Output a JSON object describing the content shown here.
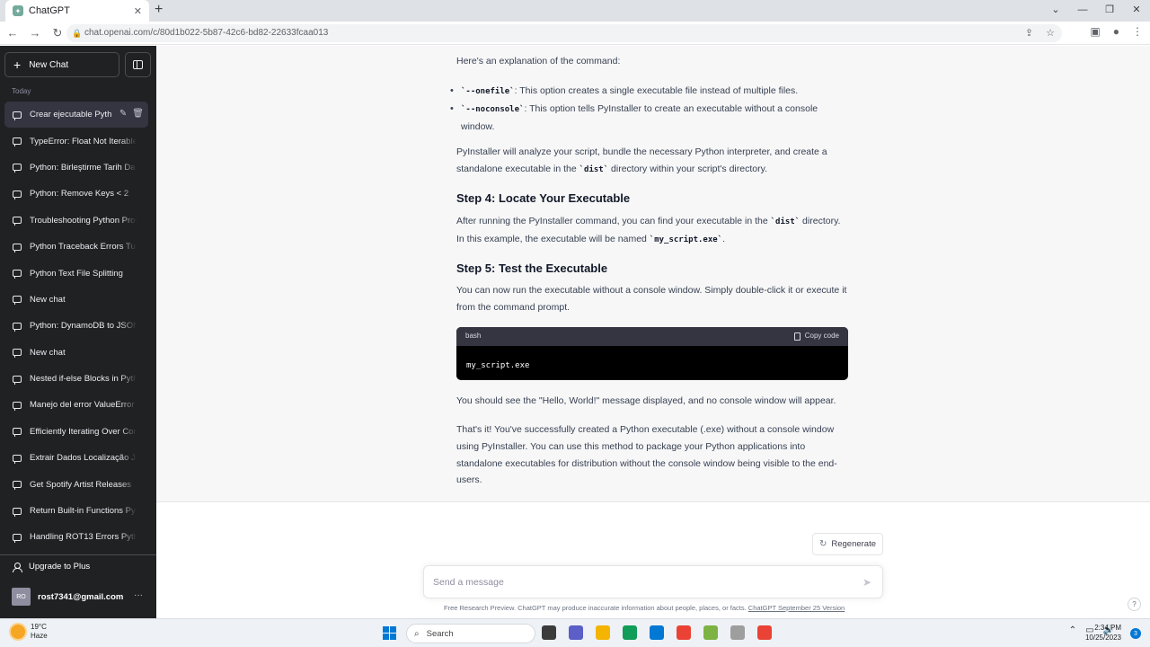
{
  "browser": {
    "tab_title": "ChatGPT",
    "url": "chat.openai.com/c/80d1b022-5b87-42c6-bd82-22633fcaa013"
  },
  "sidebar": {
    "new_chat_label": "New Chat",
    "section_label": "Today",
    "chats": [
      "Crear ejecutable Pyth",
      "TypeError: Float Not Iterable",
      "Python: Birleştirme Tarih Da",
      "Python: Remove Keys < 2",
      "Troubleshooting Python Prog",
      "Python Traceback Errors Tut",
      "Python Text File Splitting",
      "New chat",
      "Python: DynamoDB to JSON",
      "New chat",
      "Nested if-else Blocks in Pyth",
      "Manejo del error ValueError",
      "Efficiently Iterating Over Con",
      "Extrair Dados Localização JS",
      "Get Spotify Artist Releases",
      "Return Built-in Functions Pyt",
      "Handling ROT13 Errors Pytho"
    ],
    "upgrade_label": "Upgrade to Plus",
    "account_initials": "RO",
    "account_email": "rost7341@gmail.com"
  },
  "answer": {
    "intro": "Here's an explanation of the command:",
    "bullet1_code": "`--onefile`",
    "bullet1_text": ": This option creates a single executable file instead of multiple files.",
    "bullet2_code": "`--noconsole`",
    "bullet2_text": ": This option tells PyInstaller to create an executable without a console window.",
    "para1_a": "PyInstaller will analyze your script, bundle the necessary Python interpreter, and create a standalone executable in the ",
    "para1_code": "`dist`",
    "para1_b": " directory within your script's directory.",
    "step4_heading": "Step 4: Locate Your Executable",
    "step4_a": "After running the PyInstaller command, you can find your executable in the ",
    "step4_code1": "`dist`",
    "step4_b": " directory. In this example, the executable will be named ",
    "step4_code2": "`my_script.exe`",
    "step4_c": ".",
    "step5_heading": "Step 5: Test the Executable",
    "step5_text": "You can now run the executable without a console window. Simply double-click it or execute it from the command prompt.",
    "code_lang": "bash",
    "copy_label": "Copy code",
    "code": "my_script.exe",
    "para2": "You should see the \"Hello, World!\" message displayed, and no console window will appear.",
    "para3": "That's it! You've successfully created a Python executable (.exe) without a console window using PyInstaller. You can use this method to package your Python applications into standalone executables for distribution without the console window being visible to the end-users."
  },
  "composer": {
    "regenerate_label": "Regenerate",
    "placeholder": "Send a message",
    "disclaimer_text": "Free Research Preview. ChatGPT may produce inaccurate information about people, places, or facts. ",
    "disclaimer_link": "ChatGPT September 25 Version",
    "help": "?"
  },
  "taskbar": {
    "temperature": "19°C",
    "weather": "Haze",
    "search_label": "Search",
    "time": "2:34 PM",
    "date": "10/25/2023",
    "notifications": "3",
    "icon_colors": [
      "#3b3b3b",
      "#5b5fc7",
      "#f4b400",
      "#0f9d58",
      "#0078d4",
      "#ea4335",
      "#7cb342",
      "#9e9e9e",
      "#ea4335"
    ]
  }
}
